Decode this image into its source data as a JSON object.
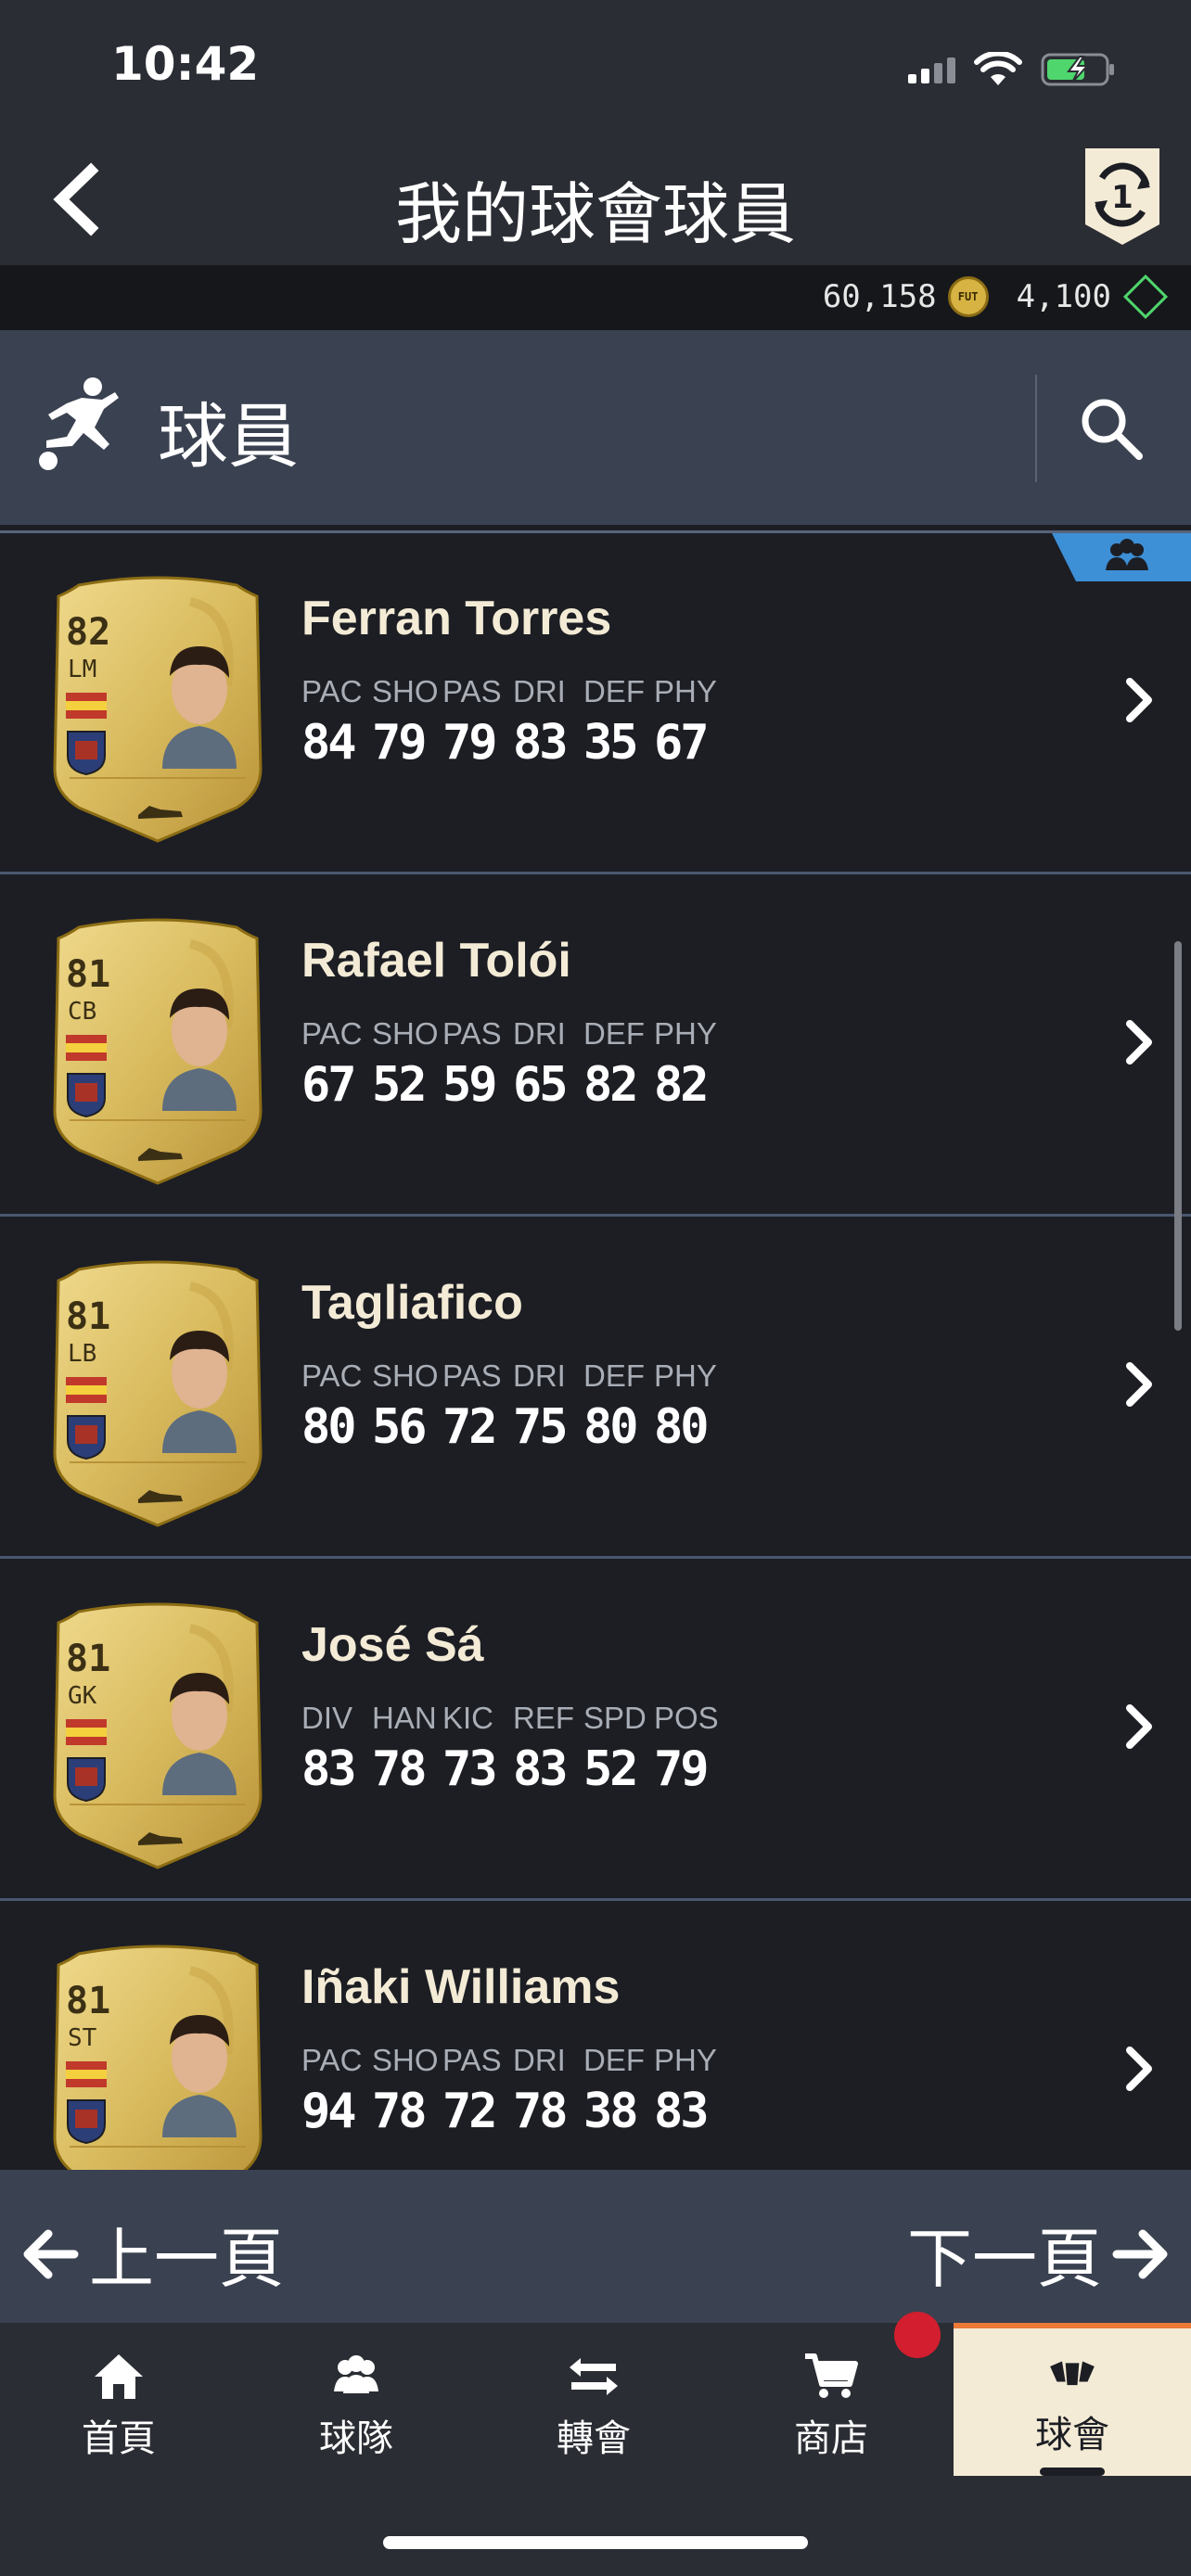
{
  "status_bar": {
    "time": "10:42"
  },
  "header": {
    "title": "我的球會球員"
  },
  "currency": {
    "coins": "60,158",
    "coin_label": "FUT",
    "points": "4,100"
  },
  "section": {
    "title": "球員"
  },
  "players": [
    {
      "rating": "82",
      "position": "LM",
      "name": "Ferran Torres",
      "stat_labels": [
        "PAC",
        "SHO",
        "PAS",
        "DRI",
        "DEF",
        "PHY"
      ],
      "stat_values": [
        "84",
        "79",
        "79",
        "83",
        "35",
        "67"
      ],
      "in_squad": true
    },
    {
      "rating": "81",
      "position": "CB",
      "name": "Rafael Tolói",
      "stat_labels": [
        "PAC",
        "SHO",
        "PAS",
        "DRI",
        "DEF",
        "PHY"
      ],
      "stat_values": [
        "67",
        "52",
        "59",
        "65",
        "82",
        "82"
      ],
      "in_squad": false
    },
    {
      "rating": "81",
      "position": "LB",
      "name": "Tagliafico",
      "stat_labels": [
        "PAC",
        "SHO",
        "PAS",
        "DRI",
        "DEF",
        "PHY"
      ],
      "stat_values": [
        "80",
        "56",
        "72",
        "75",
        "80",
        "80"
      ],
      "in_squad": false
    },
    {
      "rating": "81",
      "position": "GK",
      "name": "José Sá",
      "stat_labels": [
        "DIV",
        "HAN",
        "KIC",
        "REF",
        "SPD",
        "POS"
      ],
      "stat_values": [
        "83",
        "78",
        "73",
        "83",
        "52",
        "79"
      ],
      "in_squad": false
    },
    {
      "rating": "81",
      "position": "ST",
      "name": "Iñaki Williams",
      "stat_labels": [
        "PAC",
        "SHO",
        "PAS",
        "DRI",
        "DEF",
        "PHY"
      ],
      "stat_values": [
        "94",
        "78",
        "72",
        "78",
        "38",
        "83"
      ],
      "in_squad": false
    }
  ],
  "pager": {
    "prev": "上一頁",
    "next": "下一頁"
  },
  "tabs": [
    {
      "label": "首頁",
      "icon": "home-icon"
    },
    {
      "label": "球隊",
      "icon": "squad-icon"
    },
    {
      "label": "轉會",
      "icon": "transfer-icon"
    },
    {
      "label": "商店",
      "icon": "cart-icon"
    },
    {
      "label": "球會",
      "icon": "club-icon",
      "active": true
    }
  ],
  "colors": {
    "accent": "#ea7a36",
    "gold": "#d6b343",
    "active_tab_bg": "#f4ebd6",
    "notification": "#d21e2f"
  }
}
